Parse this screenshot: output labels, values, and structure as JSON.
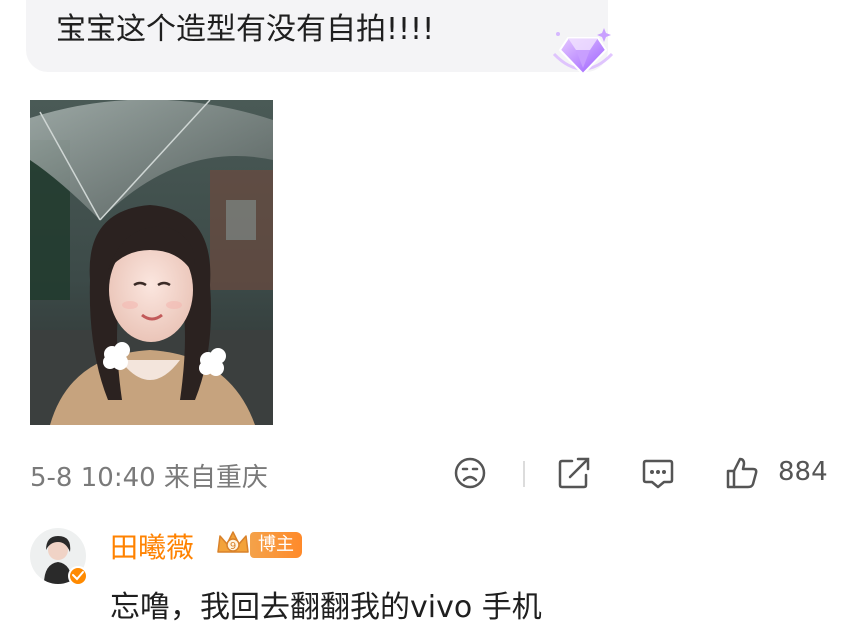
{
  "comment": {
    "text": "宝宝这个造型有没有自拍!!!!",
    "badge_icon": "gem-badge-icon"
  },
  "photo": {
    "icon": "selfie-photo"
  },
  "meta": {
    "date": "5-8 10:40 来自重庆",
    "like_count": "884"
  },
  "reply": {
    "author": "田曦薇",
    "badge_label": "博主",
    "text": "忘噜，我回去翻翻我的vivo 手机"
  },
  "colors": {
    "author_orange": "#ff8200",
    "bubble_bg": "#f4f4f6",
    "meta_gray": "#7a7a7a",
    "gem_purple": "#a36bff"
  }
}
